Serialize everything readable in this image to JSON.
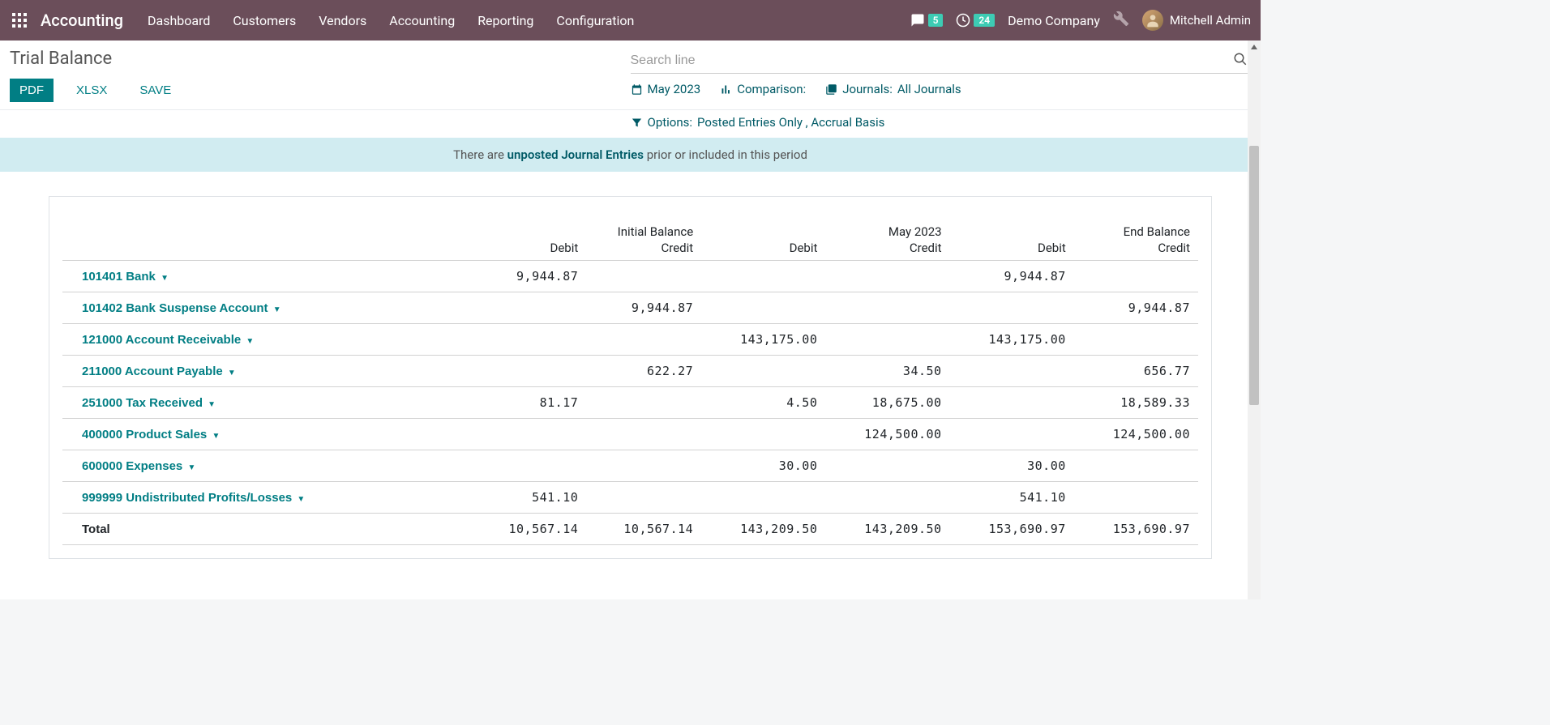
{
  "nav": {
    "brand": "Accounting",
    "menu": [
      "Dashboard",
      "Customers",
      "Vendors",
      "Accounting",
      "Reporting",
      "Configuration"
    ],
    "messages_count": "5",
    "activities_count": "24",
    "company": "Demo Company",
    "user": "Mitchell Admin"
  },
  "page": {
    "title": "Trial Balance",
    "export": {
      "pdf": "PDF",
      "xlsx": "XLSX",
      "save": "SAVE"
    },
    "search_placeholder": "Search line"
  },
  "filters": {
    "period": "May 2023",
    "comparison": "Comparison:",
    "journals_label": "Journals:",
    "journals_value": "All Journals",
    "options_label": "Options:",
    "options_value": "Posted Entries Only , Accrual Basis"
  },
  "alert": {
    "prefix": "There are ",
    "bold": "unposted Journal Entries",
    "suffix": " prior or included in this period"
  },
  "table": {
    "group_headers": [
      "Initial Balance",
      "May 2023",
      "End Balance"
    ],
    "sub_headers": [
      "Debit",
      "Credit",
      "Debit",
      "Credit",
      "Debit",
      "Credit"
    ],
    "rows": [
      {
        "name": "101401 Bank",
        "vals": [
          "9,944.87",
          "",
          "",
          "",
          "9,944.87",
          ""
        ]
      },
      {
        "name": "101402 Bank Suspense Account",
        "vals": [
          "",
          "9,944.87",
          "",
          "",
          "",
          "9,944.87"
        ]
      },
      {
        "name": "121000 Account Receivable",
        "vals": [
          "",
          "",
          "143,175.00",
          "",
          "143,175.00",
          ""
        ]
      },
      {
        "name": "211000 Account Payable",
        "vals": [
          "",
          "622.27",
          "",
          "34.50",
          "",
          "656.77"
        ]
      },
      {
        "name": "251000 Tax Received",
        "vals": [
          "81.17",
          "",
          "4.50",
          "18,675.00",
          "",
          "18,589.33"
        ]
      },
      {
        "name": "400000 Product Sales",
        "vals": [
          "",
          "",
          "",
          "124,500.00",
          "",
          "124,500.00"
        ]
      },
      {
        "name": "600000 Expenses",
        "vals": [
          "",
          "",
          "30.00",
          "",
          "30.00",
          ""
        ]
      },
      {
        "name": "999999 Undistributed Profits/Losses",
        "vals": [
          "541.10",
          "",
          "",
          "",
          "541.10",
          ""
        ]
      }
    ],
    "total": {
      "label": "Total",
      "vals": [
        "10,567.14",
        "10,567.14",
        "143,209.50",
        "143,209.50",
        "153,690.97",
        "153,690.97"
      ]
    }
  }
}
